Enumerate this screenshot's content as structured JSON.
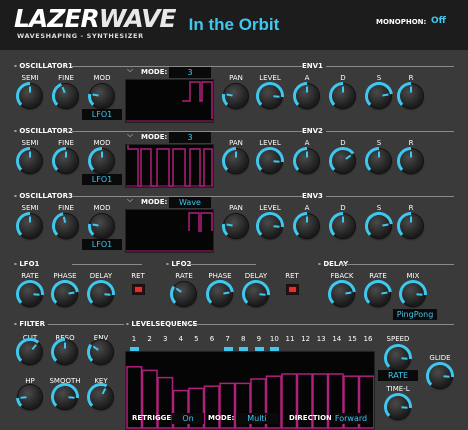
{
  "header": {
    "logo": "LAZERWAVE",
    "tagline": "WAVESHAPING - SYNTHESIZER",
    "preset_title": "In the Orbit",
    "monophon_label": "MONOPHON:",
    "monophon_value": "Off"
  },
  "colors": {
    "accent": "#3ec8f0",
    "wave": "#b0207c",
    "seq": "#b0207c",
    "led_on": "#3ec8f0",
    "ret": "#e03030"
  },
  "oscillators": [
    {
      "title": "OSCILLATOR1",
      "knobs": [
        "SEMI",
        "FINE",
        "MOD"
      ],
      "values": [
        0.5,
        0.42,
        0.2
      ],
      "mod_source": "LFO1",
      "mode_label": "MODE:",
      "mode_value": "3"
    },
    {
      "title": "OSCILLATOR2",
      "knobs": [
        "SEMI",
        "FINE",
        "MOD"
      ],
      "values": [
        0.5,
        0.5,
        0.5
      ],
      "mod_source": "LFO1",
      "mode_label": "MODE:",
      "mode_value": "3"
    },
    {
      "title": "OSCILLATOR3",
      "knobs": [
        "SEMI",
        "FINE",
        "MOD"
      ],
      "values": [
        0.5,
        0.45,
        0.2
      ],
      "mod_source": "LFO1",
      "mode_label": "MODE:",
      "mode_value": "Wave"
    }
  ],
  "envelopes": [
    {
      "title": "ENV1",
      "knobs": [
        "PAN",
        "LEVEL",
        "A",
        "D",
        "S",
        "R"
      ],
      "values": [
        0.2,
        0.85,
        0.5,
        0.5,
        0.8,
        0.5
      ]
    },
    {
      "title": "ENV2",
      "knobs": [
        "PAN",
        "LEVEL",
        "A",
        "D",
        "S",
        "R"
      ],
      "values": [
        0.5,
        0.85,
        0.5,
        0.7,
        0.5,
        0.5
      ]
    },
    {
      "title": "ENV3",
      "knobs": [
        "PAN",
        "LEVEL",
        "A",
        "D",
        "S",
        "R"
      ],
      "values": [
        0.2,
        0.85,
        0.5,
        0.5,
        0.8,
        0.5
      ]
    }
  ],
  "lfo1": {
    "title": "LFO1",
    "knobs": [
      "RATE",
      "PHASE",
      "DELAY"
    ],
    "values": [
      0.85,
      0.8,
      0.85
    ],
    "ret_label": "RET"
  },
  "lfo2": {
    "title": "LFO2",
    "knobs": [
      "RATE",
      "PHASE",
      "DELAY"
    ],
    "values": [
      0.3,
      0.8,
      0.85
    ],
    "ret_label": "RET"
  },
  "delay": {
    "title": "DELAY",
    "knobs": [
      "FBACK",
      "RATE",
      "MIX"
    ],
    "values": [
      0.8,
      0.8,
      0.85
    ],
    "mode_value": "PingPong"
  },
  "filter": {
    "title": "FILTER",
    "knobs": [
      "CUT",
      "RESO",
      "ENV",
      "HP",
      "SMOOTH",
      "KEY"
    ],
    "values": [
      0.65,
      0.5,
      0.3,
      0.15,
      0.85,
      0.6
    ]
  },
  "levelsequence": {
    "title": "LEVELSEQUENCE",
    "steps": [
      "1",
      "2",
      "3",
      "4",
      "5",
      "6",
      "7",
      "8",
      "9",
      "10",
      "11",
      "12",
      "13",
      "14",
      "15",
      "16"
    ],
    "levels": [
      0.85,
      0.8,
      0.7,
      0.52,
      0.55,
      0.58,
      0.62,
      0.62,
      0.68,
      0.72,
      0.75,
      0.75,
      0.75,
      0.75,
      0.72,
      0.72
    ],
    "active_leds": [
      1,
      0,
      0,
      0,
      0,
      0,
      1,
      1,
      1,
      1,
      0,
      0,
      0,
      0,
      0,
      0
    ],
    "retrigger_label": "RETRIGGER:",
    "retrigger_value": "On",
    "mode_label": "MODE:",
    "mode_value": "Multi",
    "direction_label": "DIRECTION:",
    "direction_value": "Forward"
  },
  "speed": {
    "speed_label": "SPEED",
    "speed_value": 0.85,
    "rate_value": "RATE",
    "timel_label": "TIME-L",
    "timel_value": 0.85
  },
  "glide": {
    "label": "GLIDE",
    "value": 0.85
  }
}
